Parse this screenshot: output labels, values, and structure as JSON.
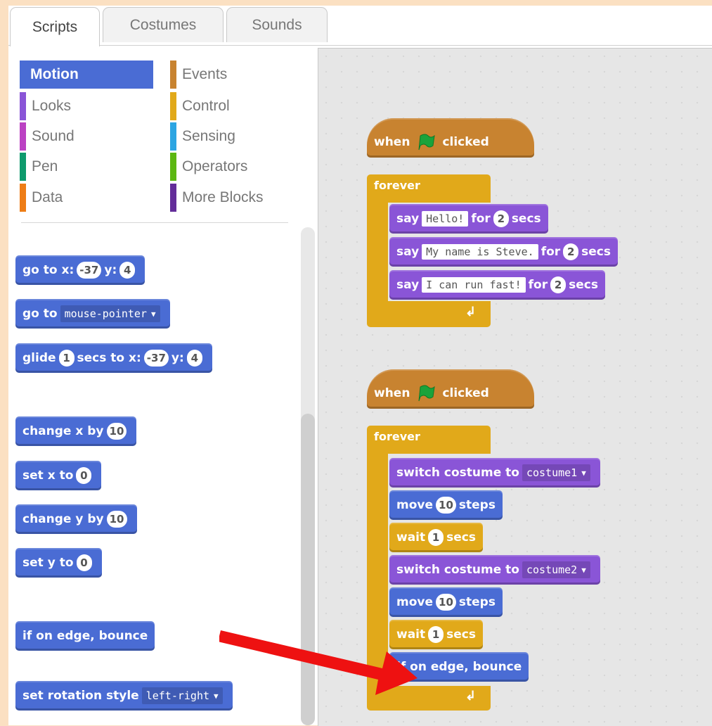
{
  "tabs": [
    "Scripts",
    "Costumes",
    "Sounds"
  ],
  "categories_left": [
    {
      "label": "Motion",
      "color": "#4a6cd4",
      "selected": true
    },
    {
      "label": "Looks",
      "color": "#8a55d7"
    },
    {
      "label": "Sound",
      "color": "#bb42c3"
    },
    {
      "label": "Pen",
      "color": "#0e9a6c"
    },
    {
      "label": "Data",
      "color": "#ee7d16"
    }
  ],
  "categories_right": [
    {
      "label": "Events",
      "color": "#c88330"
    },
    {
      "label": "Control",
      "color": "#e1a91a"
    },
    {
      "label": "Sensing",
      "color": "#2ca5e2"
    },
    {
      "label": "Operators",
      "color": "#5cb712"
    },
    {
      "label": "More Blocks",
      "color": "#632d99"
    }
  ],
  "palette": {
    "goto_xy": {
      "label": "go to x:",
      "x": "-37",
      "ylabel": "y:",
      "y": "4"
    },
    "goto": {
      "label": "go to",
      "target": "mouse-pointer"
    },
    "glide": {
      "label": "glide",
      "secs": "1",
      "mid": "secs to x:",
      "x": "-37",
      "ylabel": "y:",
      "y": "4"
    },
    "change_x": {
      "label": "change x by",
      "value": "10"
    },
    "set_x": {
      "label": "set x to",
      "value": "0"
    },
    "change_y": {
      "label": "change y by",
      "value": "10"
    },
    "set_y": {
      "label": "set y to",
      "value": "0"
    },
    "bounce": {
      "label": "if on edge, bounce"
    },
    "rotation": {
      "label": "set rotation style",
      "value": "left-right"
    }
  },
  "script1": {
    "hat_when": "when",
    "hat_clicked": "clicked",
    "forever": "forever",
    "say": [
      {
        "say": "say",
        "text": "Hello!",
        "for": "for",
        "secs_val": "2",
        "secs": "secs"
      },
      {
        "say": "say",
        "text": "My name is Steve.",
        "for": "for",
        "secs_val": "2",
        "secs": "secs"
      },
      {
        "say": "say",
        "text": "I can run fast!",
        "for": "for",
        "secs_val": "2",
        "secs": "secs"
      }
    ]
  },
  "script2": {
    "hat_when": "when",
    "hat_clicked": "clicked",
    "forever": "forever",
    "switch1": {
      "label": "switch costume to",
      "value": "costume1"
    },
    "move1": {
      "label": "move",
      "value": "10",
      "unit": "steps"
    },
    "wait1": {
      "label": "wait",
      "value": "1",
      "unit": "secs"
    },
    "switch2": {
      "label": "switch costume to",
      "value": "costume2"
    },
    "move2": {
      "label": "move",
      "value": "10",
      "unit": "steps"
    },
    "wait2": {
      "label": "wait",
      "value": "1",
      "unit": "secs"
    },
    "bounce": {
      "label": "if on edge, bounce"
    }
  },
  "colors": {
    "motion": "#4a6cd4",
    "looks": "#8a55d7",
    "control": "#e1a91a",
    "events": "#c88330",
    "arrow": "#ee1111",
    "flag": "#1aa33b"
  }
}
